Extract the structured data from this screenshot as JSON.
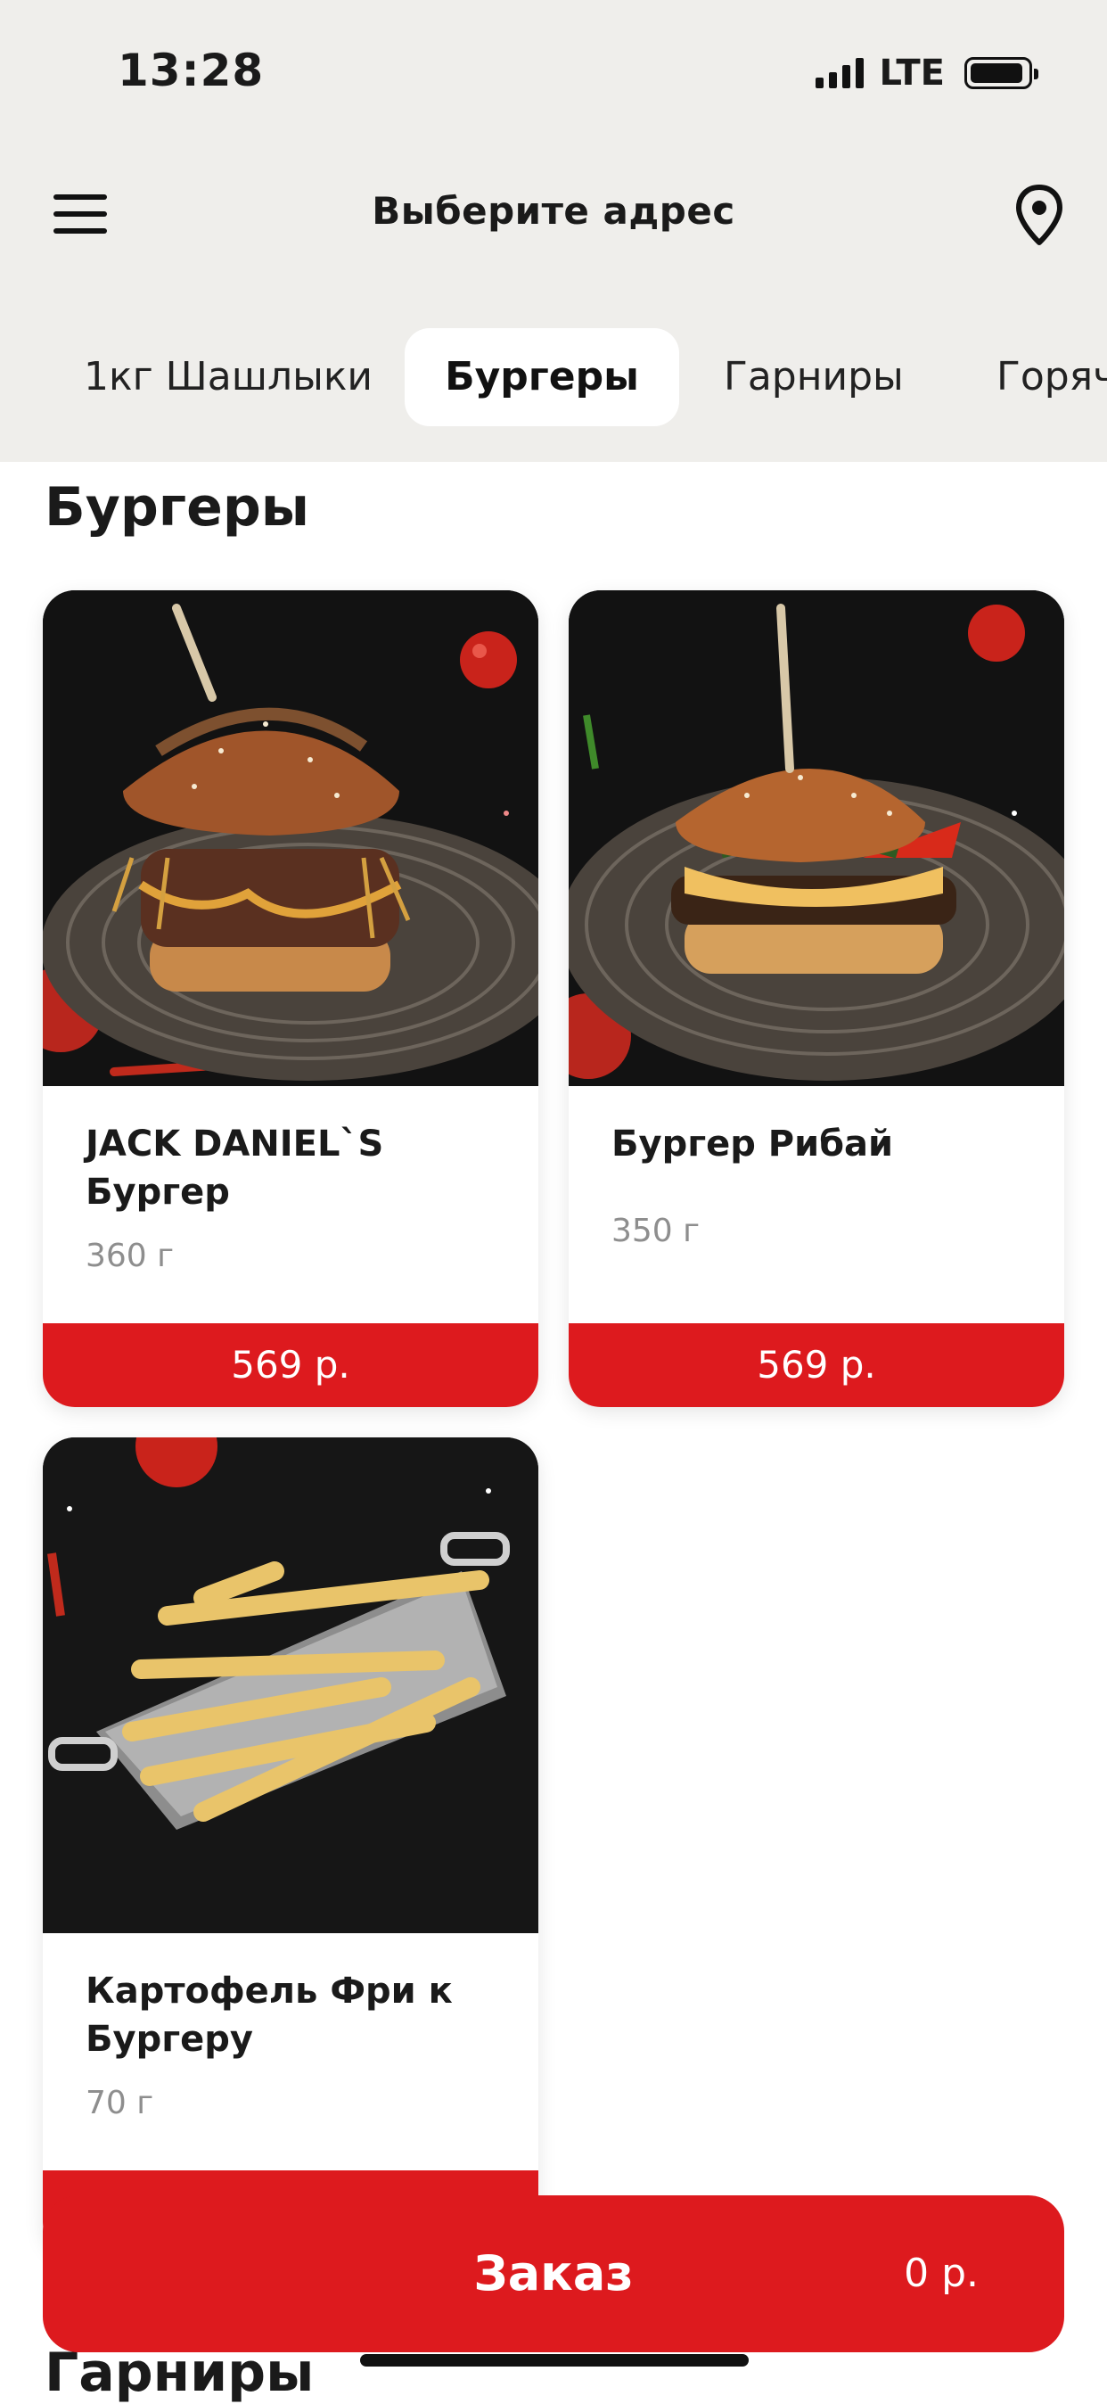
{
  "status_bar": {
    "time": "13:28",
    "network": "LTE"
  },
  "header": {
    "title": "Выберите адрес",
    "menu_icon": "hamburger-menu-icon",
    "location_icon": "location-pin-icon"
  },
  "tabs": [
    {
      "label": "1кг Шашлыки",
      "active": false
    },
    {
      "label": "Бургеры",
      "active": true
    },
    {
      "label": "Гарниры",
      "active": false
    },
    {
      "label": "Горяч",
      "active": false
    }
  ],
  "section": {
    "title": "Бургеры"
  },
  "products": [
    {
      "name": "JACK DANIEL`S Бургер",
      "weight": "360 г",
      "price": "569 р."
    },
    {
      "name": "Бургер Рибай",
      "weight": "350 г",
      "price": "569 р."
    },
    {
      "name": "Картофель Фри к Бургеру",
      "weight": "70 г",
      "price": ""
    }
  ],
  "order": {
    "label": "Заказ",
    "total": "0 р."
  },
  "next_section": {
    "title": "Гарниры"
  },
  "colors": {
    "accent": "#dd1a1e",
    "top_background": "#efeeeb"
  }
}
